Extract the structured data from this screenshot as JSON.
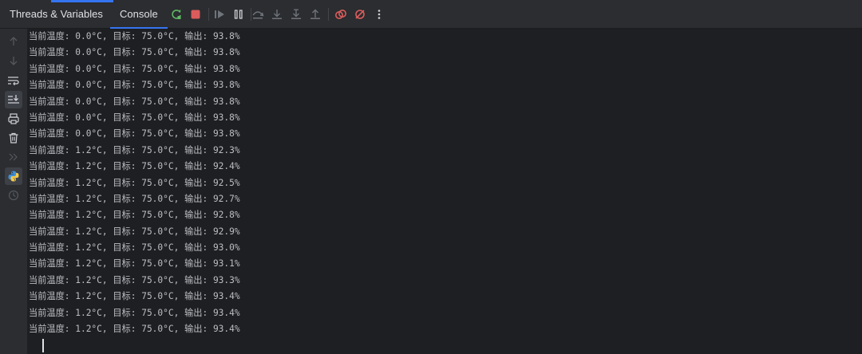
{
  "tabs": [
    {
      "label": "Threads & Variables"
    },
    {
      "label": "Console",
      "active": true
    }
  ],
  "toolbar": {
    "icons": [
      "rerun-icon",
      "stop-icon",
      "resume-icon",
      "pause-icon",
      "step-over-icon",
      "step-into-icon",
      "step-into-my-code-icon",
      "step-out-icon",
      "view-breakpoints-icon",
      "mute-breakpoints-icon",
      "more-options-icon"
    ]
  },
  "sidebar": {
    "icons": [
      "up-arrow-icon",
      "down-arrow-icon",
      "soft-wrap-icon",
      "scroll-to-end-icon",
      "print-icon",
      "trash-icon",
      "double-chevron-icon",
      "python-console-icon",
      "clock-icon"
    ]
  },
  "console": {
    "lines": [
      "当前温度: 0.0°C, 目标: 75.0°C, 输出: 93.8%",
      "当前温度: 0.0°C, 目标: 75.0°C, 输出: 93.8%",
      "当前温度: 0.0°C, 目标: 75.0°C, 输出: 93.8%",
      "当前温度: 0.0°C, 目标: 75.0°C, 输出: 93.8%",
      "当前温度: 0.0°C, 目标: 75.0°C, 输出: 93.8%",
      "当前温度: 0.0°C, 目标: 75.0°C, 输出: 93.8%",
      "当前温度: 0.0°C, 目标: 75.0°C, 输出: 93.8%",
      "当前温度: 1.2°C, 目标: 75.0°C, 输出: 92.3%",
      "当前温度: 1.2°C, 目标: 75.0°C, 输出: 92.4%",
      "当前温度: 1.2°C, 目标: 75.0°C, 输出: 92.5%",
      "当前温度: 1.2°C, 目标: 75.0°C, 输出: 92.7%",
      "当前温度: 1.2°C, 目标: 75.0°C, 输出: 92.8%",
      "当前温度: 1.2°C, 目标: 75.0°C, 输出: 92.9%",
      "当前温度: 1.2°C, 目标: 75.0°C, 输出: 93.0%",
      "当前温度: 1.2°C, 目标: 75.0°C, 输出: 93.1%",
      "当前温度: 1.2°C, 目标: 75.0°C, 输出: 93.3%",
      "当前温度: 1.2°C, 目标: 75.0°C, 输出: 93.4%",
      "当前温度: 1.2°C, 目标: 75.0°C, 输出: 93.4%",
      "当前温度: 1.2°C, 目标: 75.0°C, 输出: 93.4%"
    ]
  },
  "colors": {
    "background": "#1e1f22",
    "panel": "#2b2d30",
    "accent": "#3574f0",
    "rerun_green": "#5fb865",
    "stop_red": "#db5c5c",
    "text": "#bcbec4"
  }
}
